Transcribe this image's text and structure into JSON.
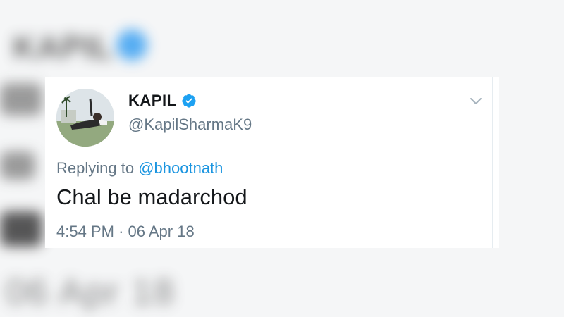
{
  "background_echo": {
    "name": "KAPIL",
    "date": "06 Apr 18"
  },
  "tweet": {
    "display_name": "KAPIL",
    "verified": true,
    "handle": "@KapilSharmaK9",
    "reply_prefix": "Replying to",
    "reply_mention": "@bhootnath",
    "text": "Chal be madarchod",
    "time": "4:54 PM",
    "separator": "·",
    "date": "06 Apr 18",
    "icons": {
      "verified": "verified-badge-icon",
      "menu": "chevron-down-icon"
    },
    "colors": {
      "verified": "#1da1f2",
      "mention": "#1b95e0",
      "secondary_text": "#657786",
      "primary_text": "#14171a"
    }
  }
}
